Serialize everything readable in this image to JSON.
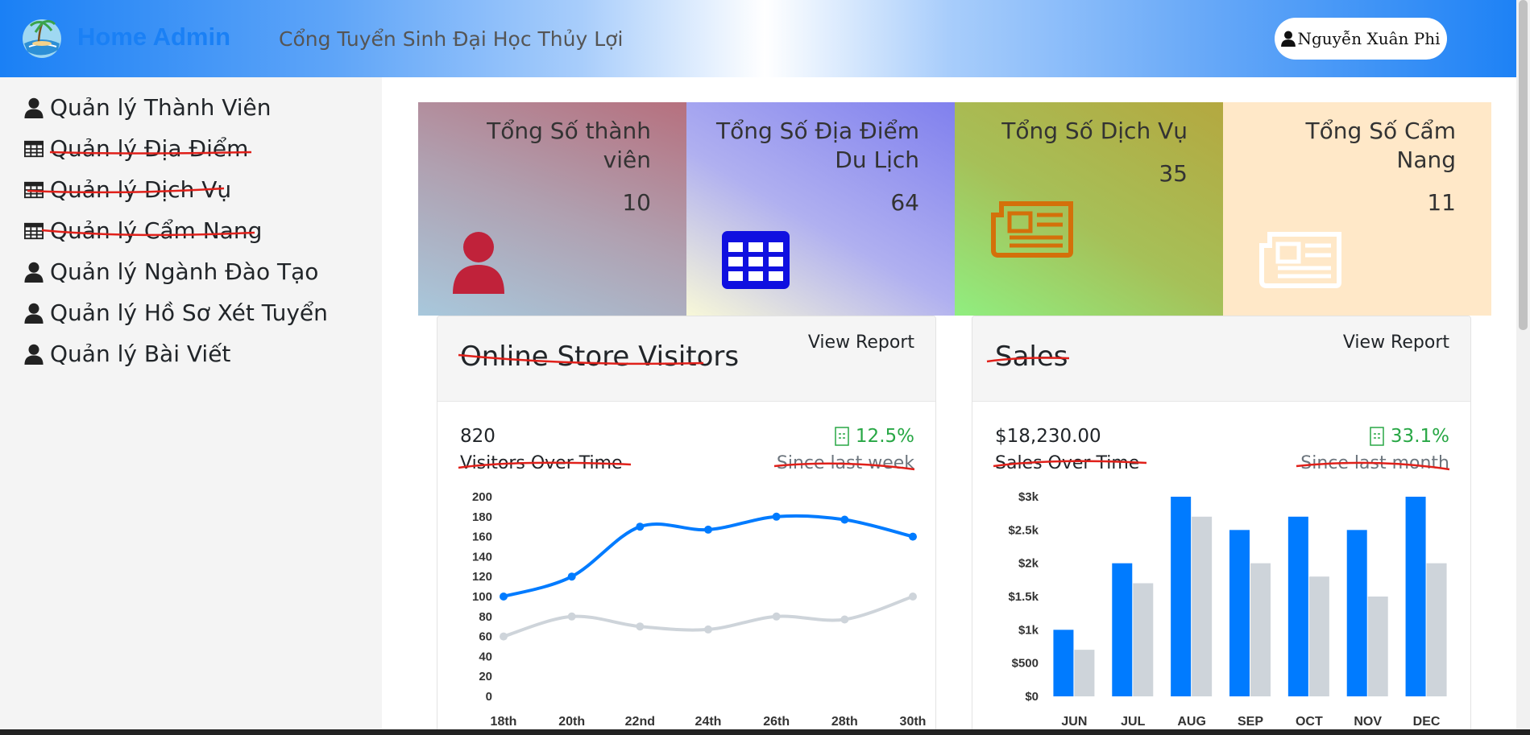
{
  "header": {
    "brand": "Home Admin",
    "title": "Cổng Tuyển Sinh Đại Học Thủy Lợi",
    "user_name": "Nguyễn Xuân Phi",
    "colors": {
      "brand": "#1a80f5"
    }
  },
  "sidebar": {
    "items": [
      {
        "label": "Quản lý Thành Viên",
        "icon": "user-icon",
        "struck": false
      },
      {
        "label": "Quản lý Địa Điểm",
        "icon": "table-icon",
        "struck": true
      },
      {
        "label": "Quản lý Dịch Vụ",
        "icon": "table-icon",
        "struck": true
      },
      {
        "label": "Quản lý Cẩm Nang",
        "icon": "table-icon",
        "struck": true
      },
      {
        "label": "Quản lý Ngành Đào Tạo",
        "icon": "user-icon",
        "struck": false
      },
      {
        "label": "Quản lý Hồ Sơ Xét Tuyển",
        "icon": "user-icon",
        "struck": false
      },
      {
        "label": "Quản lý Bài Viết",
        "icon": "user-icon",
        "struck": false
      }
    ]
  },
  "stats": [
    {
      "label": "Tổng Số thành viên",
      "value": "10",
      "icon": "user-icon",
      "color": "#c0223a"
    },
    {
      "label": "Tổng Số Địa Điểm Du Lịch",
      "value": "64",
      "icon": "table-icon",
      "color": "#1010e0"
    },
    {
      "label": "Tổng Số Dịch Vụ",
      "value": "35",
      "icon": "newspaper-icon",
      "color": "#d4700a"
    },
    {
      "label": "Tổng Số Cẩm Nang",
      "value": "11",
      "icon": "newspaper-icon",
      "color": "#ffffff"
    }
  ],
  "visitors_panel": {
    "title": "Online Store Visitors",
    "view_report": "View Report",
    "value": "820",
    "percent": "12.5%",
    "subtitle": "Visitors Over Time",
    "since": "Since last week"
  },
  "sales_panel": {
    "title": "Sales",
    "view_report": "View Report",
    "value": "$18,230.00",
    "percent": "33.1%",
    "subtitle": "Sales Over Time",
    "since": "Since last month"
  },
  "chart_data": [
    {
      "type": "line",
      "x": [
        "18th",
        "20th",
        "22nd",
        "24th",
        "26th",
        "28th",
        "30th"
      ],
      "series": [
        {
          "values": [
            100,
            120,
            170,
            167,
            180,
            177,
            160
          ],
          "color": "#007bff"
        },
        {
          "values": [
            60,
            80,
            70,
            67,
            80,
            77,
            100
          ],
          "color": "#ced4da"
        }
      ],
      "ylim": [
        0,
        200
      ],
      "yticks": [
        "0",
        "20",
        "40",
        "60",
        "80",
        "100",
        "120",
        "140",
        "160",
        "180",
        "200"
      ],
      "grid": false
    },
    {
      "type": "bar",
      "categories": [
        "JUN",
        "JUL",
        "AUG",
        "SEP",
        "OCT",
        "NOV",
        "DEC"
      ],
      "series": [
        {
          "values": [
            1000,
            2000,
            3000,
            2500,
            2700,
            2500,
            3000
          ],
          "color": "#007bff"
        },
        {
          "values": [
            700,
            1700,
            2700,
            2000,
            1800,
            1500,
            2000
          ],
          "color": "#ced4da"
        }
      ],
      "ylim": [
        0,
        3000
      ],
      "yticks": [
        "$0",
        "$500",
        "$1k",
        "$1.5k",
        "$2k",
        "$2.5k",
        "$3k"
      ],
      "grid": false
    }
  ]
}
